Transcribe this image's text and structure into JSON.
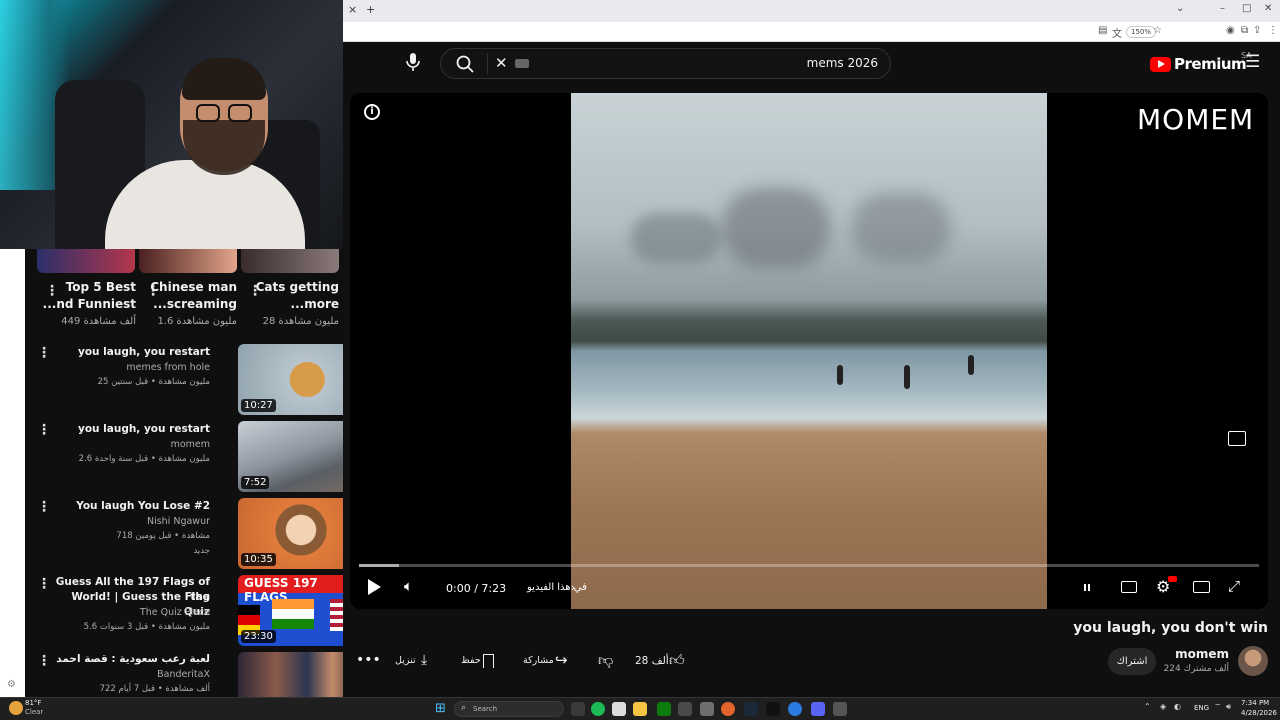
{
  "browser": {
    "new_tab": "+",
    "close_tab": "×",
    "zoom": "150%"
  },
  "search": {
    "query": "mems 2026",
    "clear": "✕"
  },
  "brand": {
    "logo_text": "Premium",
    "country": "SA"
  },
  "shorts": [
    {
      "title_line1": "Top 5 Best",
      "title_line2": "...nd Funniest",
      "views": "449 ألف مشاهدة"
    },
    {
      "title_line1": "Chinese man",
      "title_line2": "...screaming",
      "views": "1.6 مليون مشاهدة"
    },
    {
      "title_line1": "Cats getting",
      "title_line2": "...more",
      "views": "28 مليون مشاهدة"
    }
  ],
  "videos": [
    {
      "title": "you laugh, you restart",
      "title2": "",
      "channel": "memes from hole",
      "meta": "25 مليون مشاهدة • قبل سنتين",
      "badge": "",
      "duration": "10:27"
    },
    {
      "title": "you laugh, you restart",
      "title2": "",
      "channel": "momem",
      "meta": "2.6 مليون مشاهدة • قبل سنة واحدة",
      "badge": "",
      "duration": "7:52"
    },
    {
      "title": "You laugh You Lose #2",
      "title2": "",
      "channel": "Nishi Ngawur",
      "meta": "718 مشاهدة • قبل يومين",
      "badge": "جديد",
      "duration": "10:35"
    },
    {
      "title": "Guess All the 197 Flags of the",
      "title2": "World! | Guess the Flag Quiz",
      "channel": "The Quiz Place",
      "meta": "5.6 مليون مشاهدة • قبل 3 سنوات",
      "badge": "",
      "duration": "23:30",
      "thumb_text": "GUESS 197 FLAGS"
    },
    {
      "title": "لعبة رعب سعودية : قصة احمد",
      "title2": "",
      "channel": "BanderitaX",
      "meta": "722 ألف مشاهدة • قبل 7 أيام",
      "badge": "",
      "duration": ""
    }
  ],
  "player": {
    "watermark": "MOMEM",
    "time": "0:00 / 7:23",
    "chapter": "في هذا الفيديو",
    "progress": 0.0
  },
  "video_info": {
    "title": "you laugh, you don't win",
    "channel": "momem",
    "subscribers": "224 ألف مشترك",
    "subscribe_label": "اشتراك",
    "likes": "28 ألف",
    "share_label": "مشاركة",
    "save_label": "حفظ",
    "download_label": "تنزيل"
  },
  "taskbar": {
    "weather_temp": "81°F",
    "weather_cond": "Clear",
    "search_placeholder": "Search",
    "lang": "ENG",
    "time": "7:34 PM",
    "date": "4/28/2026"
  },
  "colors": {
    "brand_red": "#ff0000",
    "background": "#0f0f0f",
    "text": "#f1f1f1",
    "muted": "#aaaaaa"
  }
}
